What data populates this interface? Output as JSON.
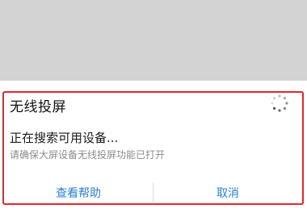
{
  "dialog": {
    "title": "无线投屏",
    "status_text": "正在搜索可用设备...",
    "hint_text": "请确保大屏设备无线投屏功能已打开",
    "help_button": "查看帮助",
    "cancel_button": "取消",
    "spinner_icon": "loading-spinner-icon"
  },
  "colors": {
    "accent": "#2a7fd4",
    "highlight_border": "#e3272d",
    "backdrop": "#d3d3d3"
  }
}
